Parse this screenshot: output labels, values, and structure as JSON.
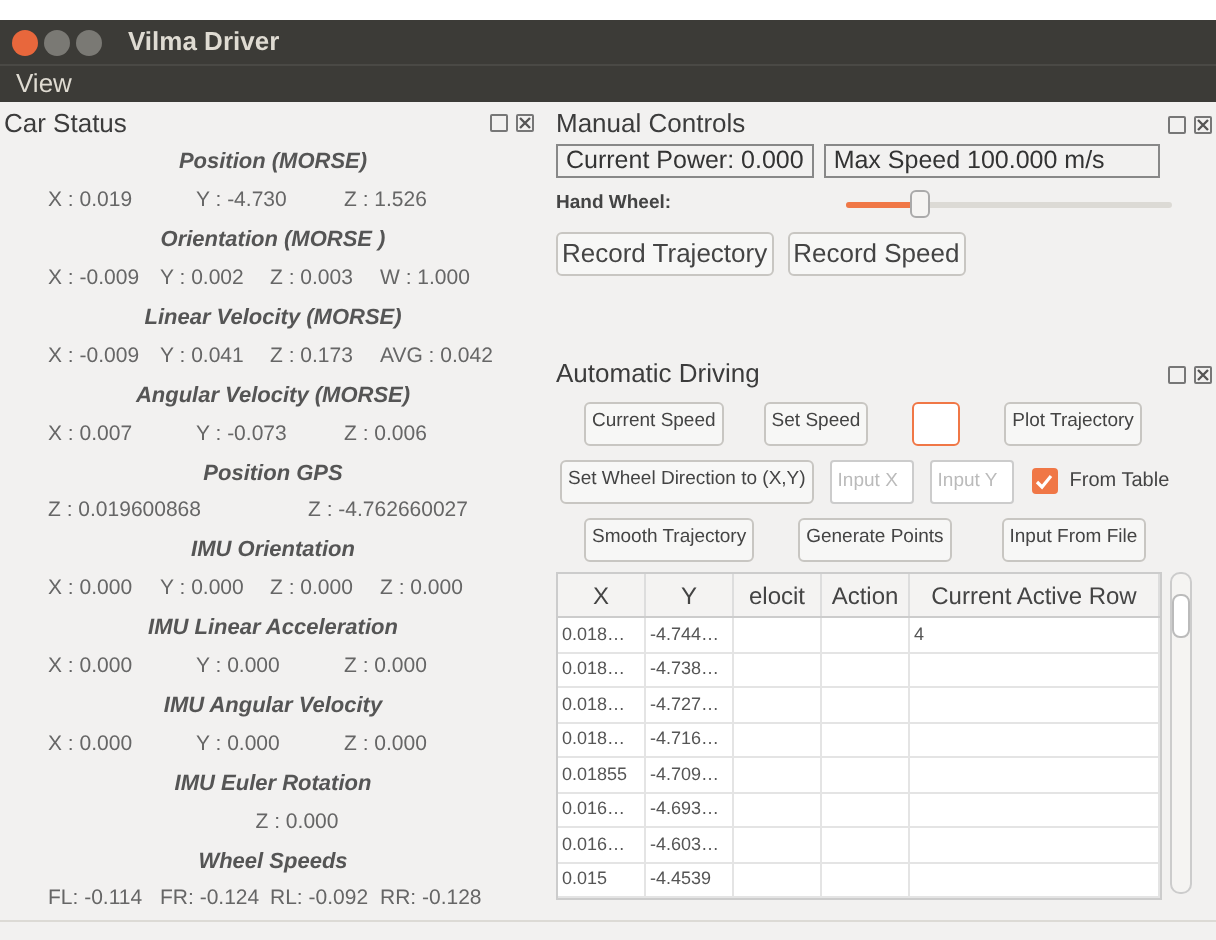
{
  "window": {
    "title": "Vilma Driver"
  },
  "menu": [
    "View"
  ],
  "car_status": {
    "title": "Car Status",
    "sections": [
      {
        "heading": "Position (MORSE)",
        "values": [
          "X : 0.019",
          "Y : -4.730",
          "Z : 1.526"
        ]
      },
      {
        "heading": "Orientation (MORSE )",
        "values": [
          "X : -0.009",
          "Y : 0.002",
          "Z : 0.003",
          "W : 1.000"
        ]
      },
      {
        "heading": "Linear Velocity (MORSE)",
        "values": [
          "X : -0.009",
          "Y : 0.041",
          "Z : 0.173",
          "AVG : 0.042"
        ]
      },
      {
        "heading": "Angular Velocity (MORSE)",
        "values": [
          "X : 0.007",
          "Y : -0.073",
          "Z : 0.006"
        ]
      },
      {
        "heading": "Position GPS",
        "values": [
          "Z : 0.019600868",
          "Z : -4.762660027"
        ]
      },
      {
        "heading": "IMU Orientation",
        "values": [
          "X : 0.000",
          "Y : 0.000",
          "Z : 0.000",
          "Z : 0.000"
        ]
      },
      {
        "heading": "IMU Linear Acceleration",
        "values": [
          "X : 0.000",
          "Y : 0.000",
          "Z : 0.000"
        ]
      },
      {
        "heading": "IMU Angular Velocity",
        "values": [
          "X : 0.000",
          "Y : 0.000",
          "Z : 0.000"
        ]
      },
      {
        "heading": "IMU Euler Rotation",
        "values": [
          "Z : 0.000"
        ]
      },
      {
        "heading": "Wheel Speeds",
        "values": [
          "FL: -0.114",
          "FR: -0.124",
          "RL: -0.092",
          "RR: -0.128"
        ]
      }
    ]
  },
  "manual_controls": {
    "title": "Manual Controls",
    "current_power": "Current Power: 0.000",
    "max_speed": "Max Speed 100.000 m/s",
    "hand_wheel": {
      "label": "Hand Wheel:",
      "level": 0.23
    },
    "buttons": [
      "Record Trajectory",
      "Record Speed"
    ]
  },
  "automatic_driving": {
    "title": "Automatic Driving",
    "line_1": [
      {
        "kind": "button",
        "label": "Current Speed"
      },
      {
        "kind": "button",
        "label": "Set Speed"
      },
      {
        "kind": "input",
        "focused": true
      },
      {
        "kind": "button",
        "label": "Plot Trajectory"
      }
    ],
    "line_2": [
      {
        "kind": "button",
        "label": "Set Wheel Direction to (X,Y)"
      },
      {
        "kind": "input",
        "placeholder": "Input X",
        "focused": false
      },
      {
        "kind": "input",
        "placeholder": "Input Y",
        "focused": false
      },
      {
        "kind": "checkbox",
        "label": "From Table",
        "checked": true
      }
    ],
    "line_3": [
      {
        "kind": "button",
        "label": "Smooth Trajectory"
      },
      {
        "kind": "button",
        "label": "Generate Points"
      },
      {
        "kind": "button",
        "label": "Input From File"
      }
    ],
    "table": {
      "columns": [
        "X",
        "Y",
        "elocit",
        "Action",
        "Current Active Row"
      ],
      "rows": [
        [
          "0.018…",
          "-4.744…",
          "",
          "",
          "4"
        ],
        [
          "0.018…",
          "-4.738…",
          "",
          "",
          ""
        ],
        [
          "0.018…",
          "-4.727…",
          "",
          "",
          ""
        ],
        [
          "0.018…",
          "-4.716…",
          "",
          "",
          ""
        ],
        [
          "0.01855",
          "-4.709…",
          "",
          "",
          ""
        ],
        [
          "0.016…",
          "-4.693…",
          "",
          "",
          ""
        ],
        [
          "0.016…",
          "-4.603…",
          "",
          "",
          ""
        ],
        [
          "0.015",
          "-4.4539",
          "",
          "",
          ""
        ]
      ]
    }
  }
}
